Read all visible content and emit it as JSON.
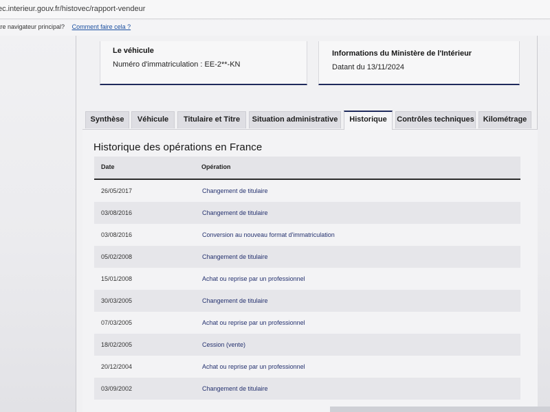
{
  "browser": {
    "url": "ec.interieur.gouv.fr/histovec/rapport-vendeur"
  },
  "info_bar": {
    "message": "tre navigateur principal?",
    "link": "Comment faire cela ?"
  },
  "vehicle_card": {
    "title": "Le véhicule",
    "registration": "Numéro d'immatriculation : EE-2**-KN"
  },
  "ministry_card": {
    "title": "Informations du Ministère de l'Intérieur",
    "date": "Datant du 13/11/2024"
  },
  "tabs": [
    {
      "label": "Synthèse"
    },
    {
      "label": "Véhicule"
    },
    {
      "label": "Titulaire et Titre"
    },
    {
      "label": "Situation administrative"
    },
    {
      "label": "Historique"
    },
    {
      "label": "Contrôles techniques"
    },
    {
      "label": "Kilométrage"
    }
  ],
  "active_tab": "Historique",
  "history": {
    "title": "Historique des opérations en France",
    "columns": {
      "date": "Date",
      "operation": "Opération"
    },
    "rows": [
      {
        "date": "26/05/2017",
        "operation": "Changement de titulaire"
      },
      {
        "date": "03/08/2016",
        "operation": "Changement de titulaire"
      },
      {
        "date": "03/08/2016",
        "operation": "Conversion au nouveau format d'immatriculation"
      },
      {
        "date": "05/02/2008",
        "operation": "Changement de titulaire"
      },
      {
        "date": "15/01/2008",
        "operation": "Achat ou reprise par un professionnel"
      },
      {
        "date": "30/03/2005",
        "operation": "Changement de titulaire"
      },
      {
        "date": "07/03/2005",
        "operation": "Achat ou reprise par un professionnel"
      },
      {
        "date": "18/02/2005",
        "operation": "Cession (vente)"
      },
      {
        "date": "20/12/2004",
        "operation": "Achat ou reprise par un professionnel"
      },
      {
        "date": "03/09/2002",
        "operation": "Changement de titulaire"
      }
    ]
  },
  "colors": {
    "accent": "#1f2a5c",
    "link": "#23306e"
  }
}
